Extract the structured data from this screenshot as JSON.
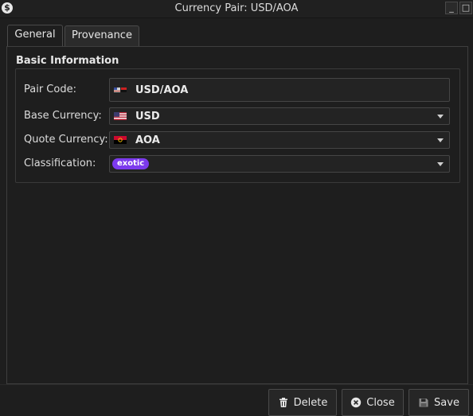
{
  "window": {
    "title": "Currency Pair: USD/AOA",
    "app_icon": "dollar-icon",
    "minimize_label": "_",
    "maximize_label": "□"
  },
  "tabs": [
    {
      "label": "General",
      "active": true
    },
    {
      "label": "Provenance",
      "active": false
    }
  ],
  "basic_info": {
    "title": "Basic Information",
    "pair_code": {
      "label": "Pair Code:",
      "value": "USD/AOA"
    },
    "base_currency": {
      "label": "Base Currency:",
      "value": "USD"
    },
    "quote_currency": {
      "label": "Quote Currency:",
      "value": "AOA"
    },
    "classification": {
      "label": "Classification:",
      "value": "exotic",
      "badge_color": "#7c3aed"
    }
  },
  "buttons": {
    "delete": "Delete",
    "close": "Close",
    "save": "Save"
  },
  "colors": {
    "background": "#1e1e1e",
    "accent": "#7c3aed"
  }
}
